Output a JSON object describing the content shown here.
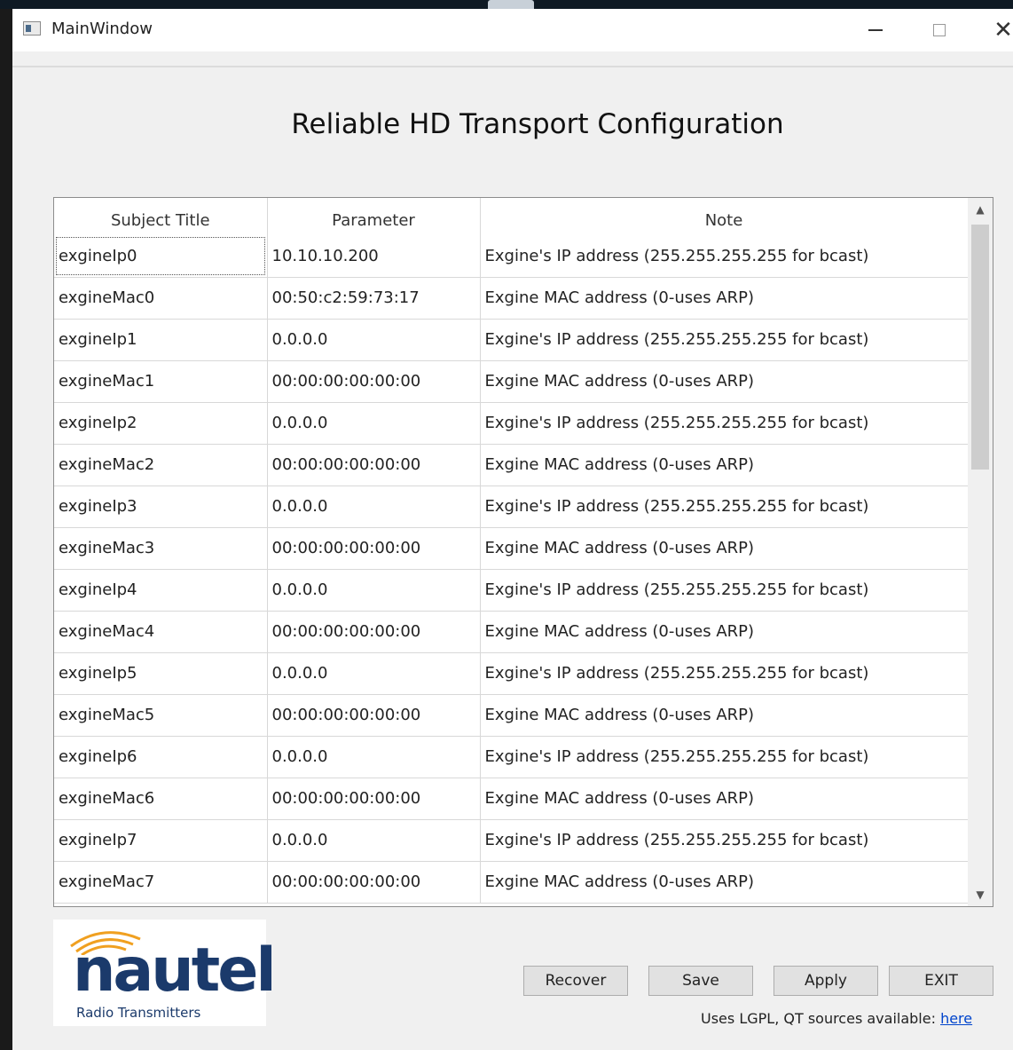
{
  "window": {
    "title": "MainWindow",
    "controls": {
      "minimize": "—",
      "maximize": "",
      "close": "✕"
    }
  },
  "heading": "Reliable HD Transport Configuration",
  "table": {
    "columns": [
      "Subject Title",
      "Parameter",
      "Note"
    ],
    "rows": [
      [
        "exgineIp0",
        "10.10.10.200",
        "Exgine's IP address (255.255.255.255 for bcast)"
      ],
      [
        "exgineMac0",
        "00:50:c2:59:73:17",
        "Exgine MAC address (0-uses ARP)"
      ],
      [
        "exgineIp1",
        "0.0.0.0",
        "Exgine's IP address (255.255.255.255 for bcast)"
      ],
      [
        "exgineMac1",
        "00:00:00:00:00:00",
        "Exgine MAC address (0-uses ARP)"
      ],
      [
        "exgineIp2",
        "0.0.0.0",
        "Exgine's IP address (255.255.255.255 for bcast)"
      ],
      [
        "exgineMac2",
        "00:00:00:00:00:00",
        "Exgine MAC address (0-uses ARP)"
      ],
      [
        "exgineIp3",
        "0.0.0.0",
        "Exgine's IP address (255.255.255.255 for bcast)"
      ],
      [
        "exgineMac3",
        "00:00:00:00:00:00",
        "Exgine MAC address (0-uses ARP)"
      ],
      [
        "exgineIp4",
        "0.0.0.0",
        "Exgine's IP address (255.255.255.255 for bcast)"
      ],
      [
        "exgineMac4",
        "00:00:00:00:00:00",
        "Exgine MAC address (0-uses ARP)"
      ],
      [
        "exgineIp5",
        "0.0.0.0",
        "Exgine's IP address (255.255.255.255 for bcast)"
      ],
      [
        "exgineMac5",
        "00:00:00:00:00:00",
        "Exgine MAC address (0-uses ARP)"
      ],
      [
        "exgineIp6",
        "0.0.0.0",
        "Exgine's IP address (255.255.255.255 for bcast)"
      ],
      [
        "exgineMac6",
        "00:00:00:00:00:00",
        "Exgine MAC address (0-uses ARP)"
      ],
      [
        "exgineIp7",
        "0.0.0.0",
        "Exgine's IP address (255.255.255.255 for bcast)"
      ],
      [
        "exgineMac7",
        "00:00:00:00:00:00",
        "Exgine MAC address (0-uses ARP)"
      ]
    ]
  },
  "logo": {
    "word": "nautel",
    "subtitle": "Radio Transmitters"
  },
  "buttons": {
    "recover": "Recover",
    "save": "Save",
    "apply": "Apply",
    "exit": "EXIT"
  },
  "footer": {
    "text": "Uses LGPL, QT sources available: ",
    "link": "here"
  },
  "icons": {
    "scroll_up": "chevron-up-icon",
    "scroll_down": "chevron-down-icon",
    "app": "window-app-icon"
  },
  "colors": {
    "logo_blue": "#1b3a6b",
    "logo_orange": "#f0a020",
    "link": "#0044cc"
  }
}
